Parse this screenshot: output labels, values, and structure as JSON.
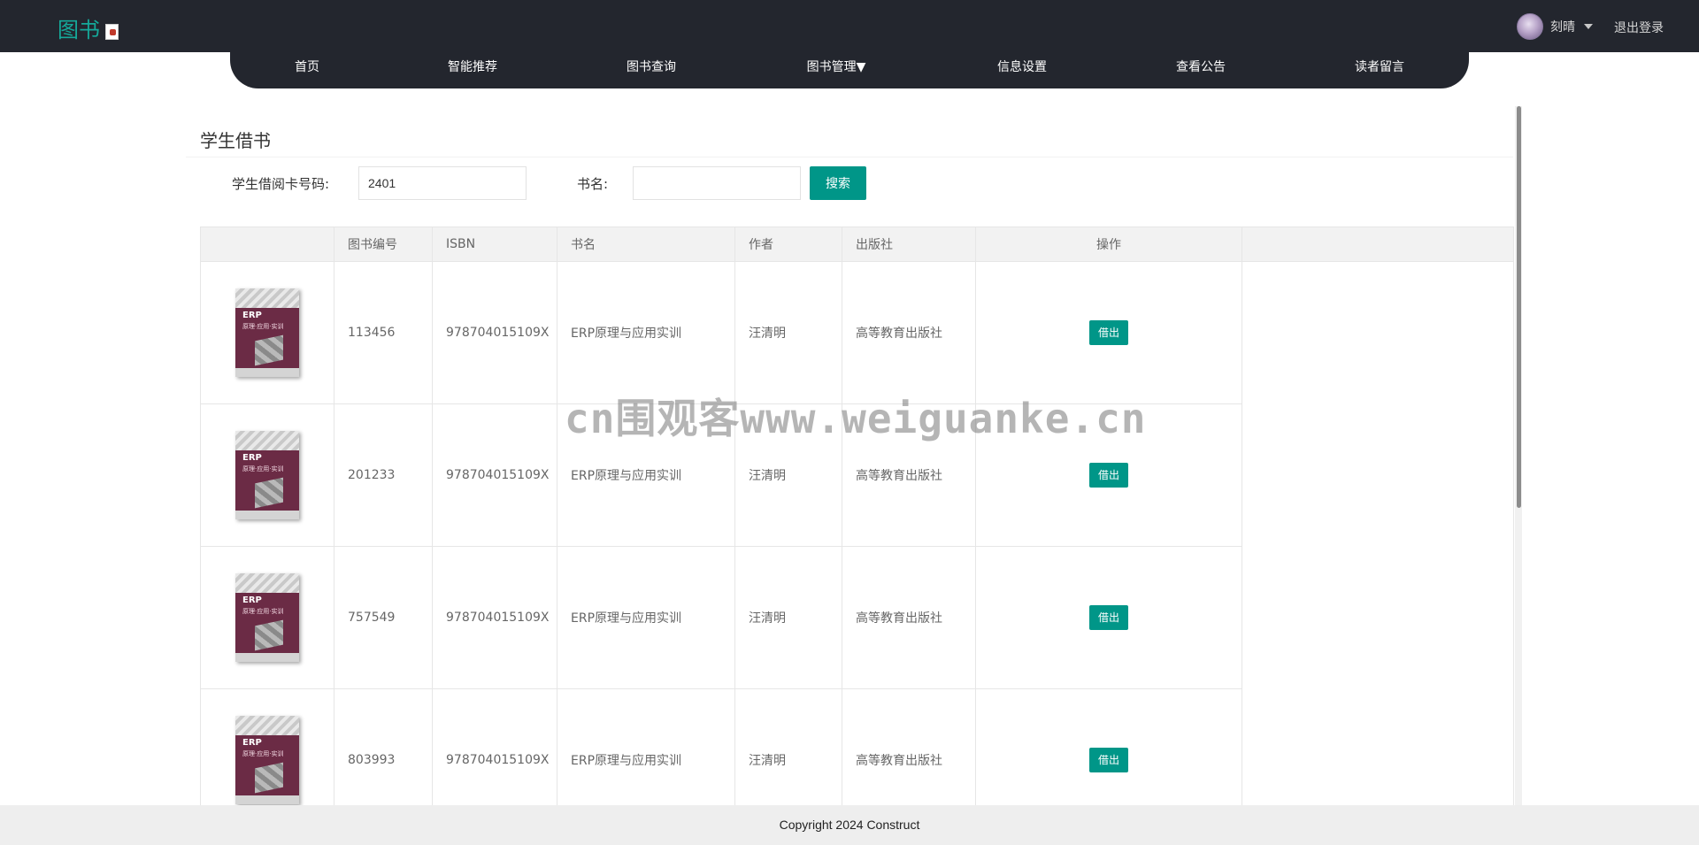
{
  "header": {
    "logo_text": "图书",
    "user_name": "刻晴",
    "logout_label": "退出登录"
  },
  "nav": {
    "items": [
      {
        "label": "首页"
      },
      {
        "label": "智能推荐"
      },
      {
        "label": "图书查询"
      },
      {
        "label": "图书管理▼"
      },
      {
        "label": "信息设置"
      },
      {
        "label": "查看公告"
      },
      {
        "label": "读者留言"
      }
    ]
  },
  "main": {
    "title": "学生借书",
    "card_label": "学生借阅卡号码:",
    "card_value": "2401",
    "book_label": "书名:",
    "book_value": "",
    "search_label": "搜索"
  },
  "table": {
    "headers": [
      "",
      "图书编号",
      "ISBN",
      "书名",
      "作者",
      "出版社",
      "操作",
      ""
    ],
    "rows": [
      {
        "id": "113456",
        "isbn": "978704015109X",
        "title": "ERP原理与应用实训",
        "author": "汪清明",
        "publisher": "高等教育出版社",
        "action": "借出"
      },
      {
        "id": "201233",
        "isbn": "978704015109X",
        "title": "ERP原理与应用实训",
        "author": "汪清明",
        "publisher": "高等教育出版社",
        "action": "借出"
      },
      {
        "id": "757549",
        "isbn": "978704015109X",
        "title": "ERP原理与应用实训",
        "author": "汪清明",
        "publisher": "高等教育出版社",
        "action": "借出"
      },
      {
        "id": "803993",
        "isbn": "978704015109X",
        "title": "ERP原理与应用实训",
        "author": "汪清明",
        "publisher": "高等教育出版社",
        "action": "借出"
      }
    ]
  },
  "cover": {
    "title": "ERP",
    "subtitle": "原理·应用·实训"
  },
  "watermark": "cn围观客www.weiguanke.cn",
  "footer": {
    "copyright": "Copyright 2024 Construct"
  },
  "colors": {
    "header_bg": "#23262e",
    "accent": "#009688",
    "logo": "#15a99a"
  }
}
